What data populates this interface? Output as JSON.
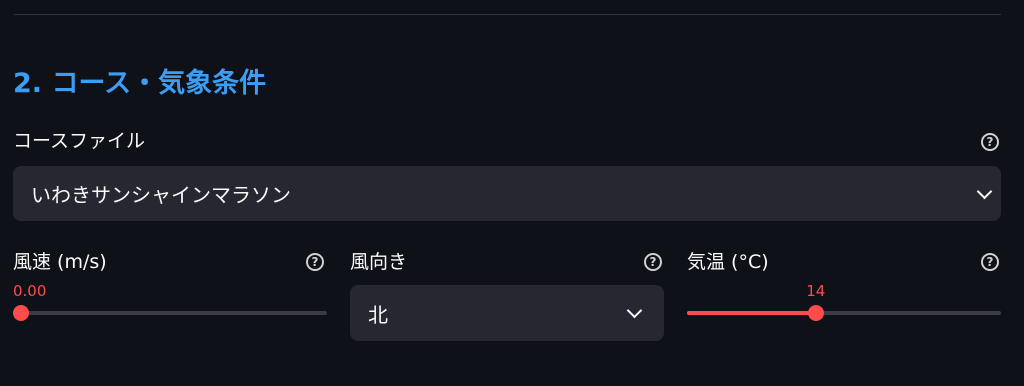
{
  "section": {
    "title": "2. コース・気象条件"
  },
  "course": {
    "label": "コースファイル",
    "value": "いわきサンシャインマラソン"
  },
  "wind_speed": {
    "label": "風速 (m/s)",
    "value": "0.00",
    "fraction": 0
  },
  "wind_direction": {
    "label": "風向き",
    "value": "北"
  },
  "temperature": {
    "label": "気温 (°C)",
    "value": "14",
    "fraction": 0.41
  },
  "colors": {
    "accent": "#ff4b4b",
    "heading": "#3d9df3",
    "background": "#0e1117",
    "input_bg": "#262730"
  },
  "icons": {
    "help": "question-circle-icon",
    "dropdown": "chevron-down-icon"
  }
}
